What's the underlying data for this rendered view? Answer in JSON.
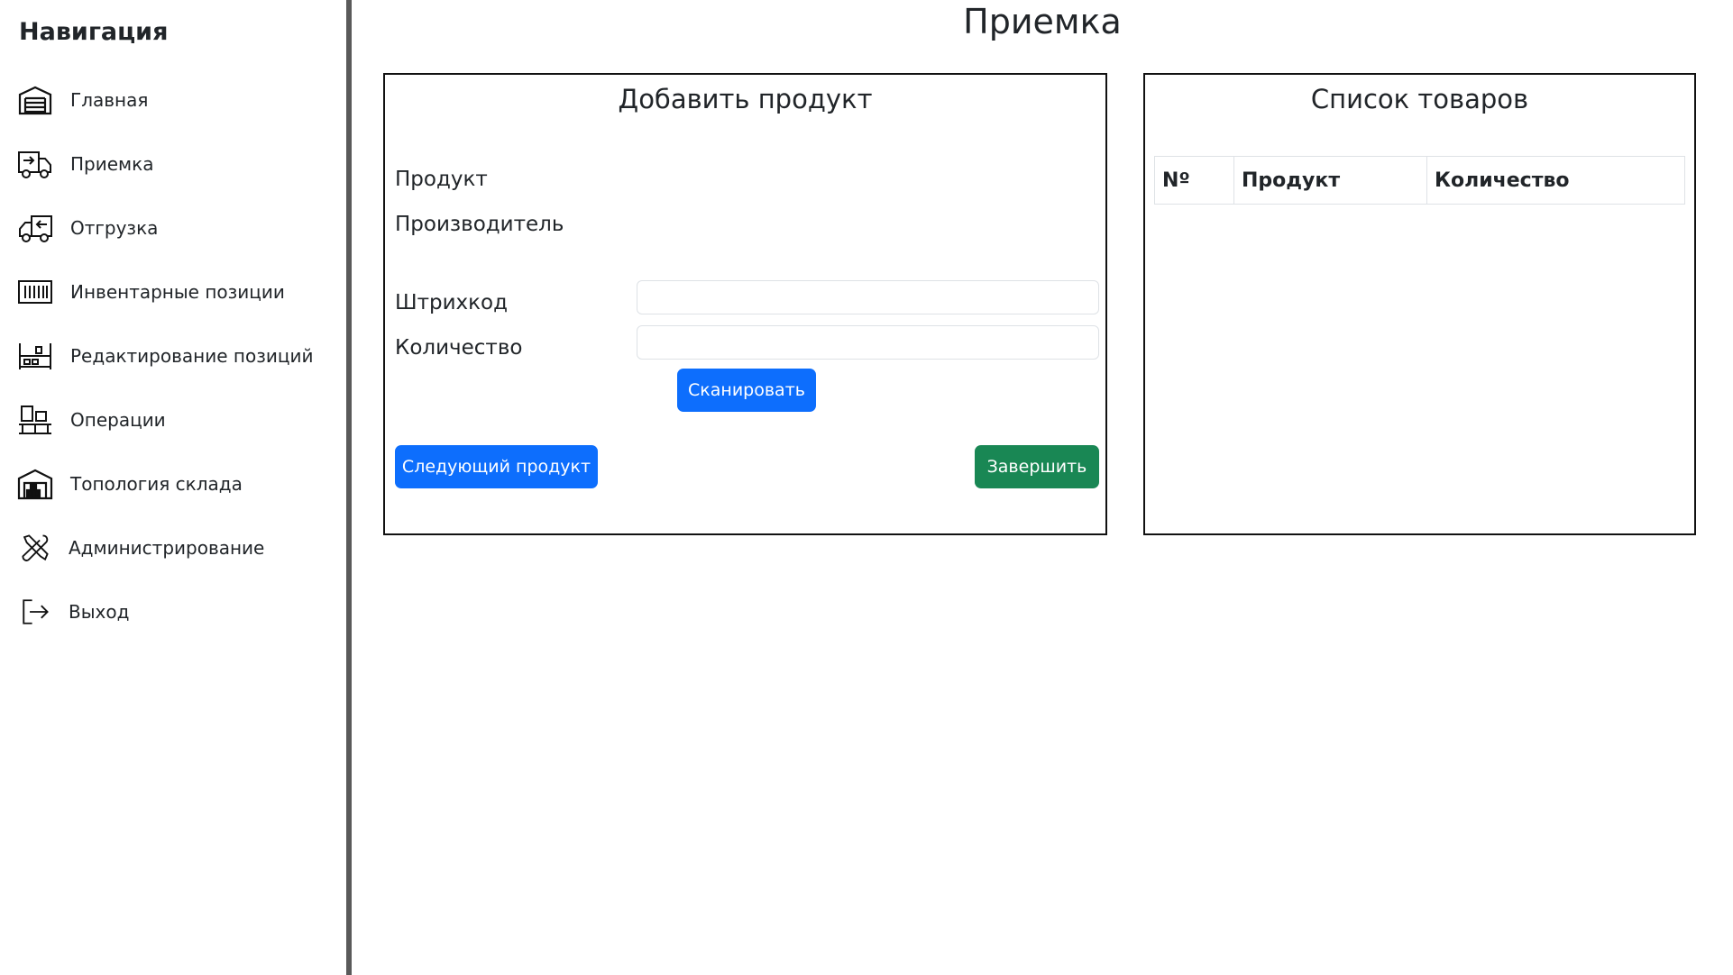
{
  "page": {
    "title": "Приемка"
  },
  "sidebar": {
    "title": "Навигация",
    "items": [
      {
        "label": "Главная",
        "icon": "warehouse-icon"
      },
      {
        "label": "Приемка",
        "icon": "truck-arrow-in-icon"
      },
      {
        "label": "Отгрузка",
        "icon": "truck-arrow-out-icon"
      },
      {
        "label": "Инвентарные позиции",
        "icon": "barcode-icon"
      },
      {
        "label": "Редактирование позиций",
        "icon": "shelf-edit-icon"
      },
      {
        "label": "Операции",
        "icon": "boxes-icon"
      },
      {
        "label": "Топология склада",
        "icon": "warehouse-layout-icon"
      },
      {
        "label": "Администрирование",
        "icon": "tools-icon"
      },
      {
        "label": "Выход",
        "icon": "logout-icon"
      }
    ]
  },
  "add_product": {
    "heading": "Добавить продукт",
    "product_label": "Продукт",
    "manufacturer_label": "Производитель",
    "barcode_label": "Штрихкод",
    "barcode_value": "",
    "quantity_label": "Количество",
    "quantity_value": "",
    "scan_button": "Сканировать",
    "next_button": "Следующий продукт",
    "finish_button": "Завершить"
  },
  "product_list": {
    "heading": "Список товаров",
    "columns": [
      "Nº",
      "Продукт",
      "Количество"
    ]
  },
  "colors": {
    "primary": "#0d6efd",
    "success": "#198754",
    "divider": "#5a5a5a"
  }
}
